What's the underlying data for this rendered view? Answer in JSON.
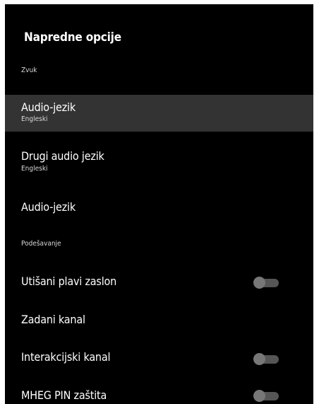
{
  "screen": {
    "title": "Napredne opcije"
  },
  "sections": {
    "sound": "Zvuk",
    "settings": "Podešavanje"
  },
  "items": {
    "audio_language": {
      "label": "Audio-jezik",
      "value": "Engleski",
      "selected": true
    },
    "second_audio_language": {
      "label": "Drugi audio jezik",
      "value": "Engleski"
    },
    "audio_language_2": {
      "label": "Audio-jezik"
    },
    "blue_mute": {
      "label": "Utišani plavi zaslon",
      "state": "off"
    },
    "default_channel": {
      "label": "Zadani kanal"
    },
    "interaction_channel": {
      "label": "Interakcijski kanal",
      "state": "off"
    },
    "mheg_pin": {
      "label": "MHEG PIN zaštita",
      "state": "off"
    }
  },
  "colors": {
    "background": "#000000",
    "selected_row": "#333333",
    "toggle_off": "#555555"
  }
}
